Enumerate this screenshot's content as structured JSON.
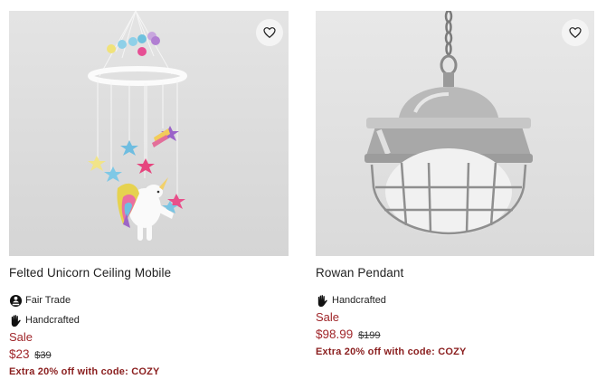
{
  "products": [
    {
      "title": "Felted Unicorn Ceiling Mobile",
      "badges": [
        {
          "label": "Fair Trade",
          "icon": "fair-trade-icon"
        },
        {
          "label": "Handcrafted",
          "icon": "handcrafted-icon"
        }
      ],
      "sale_label": "Sale",
      "price": "$23",
      "original_price": "$39",
      "promo": "Extra 20% off with code: COZY"
    },
    {
      "title": "Rowan Pendant",
      "badges": [
        {
          "label": "Handcrafted",
          "icon": "handcrafted-icon"
        }
      ],
      "sale_label": "Sale",
      "price": "$98.99",
      "original_price": "$199",
      "promo": "Extra 20% off with code: COZY"
    }
  ],
  "colors": {
    "sale": "#a0262a",
    "promo": "#8a1e1e",
    "image_background": "#dcdcdc"
  },
  "icons": {
    "favorite": "heart-outline-icon"
  }
}
